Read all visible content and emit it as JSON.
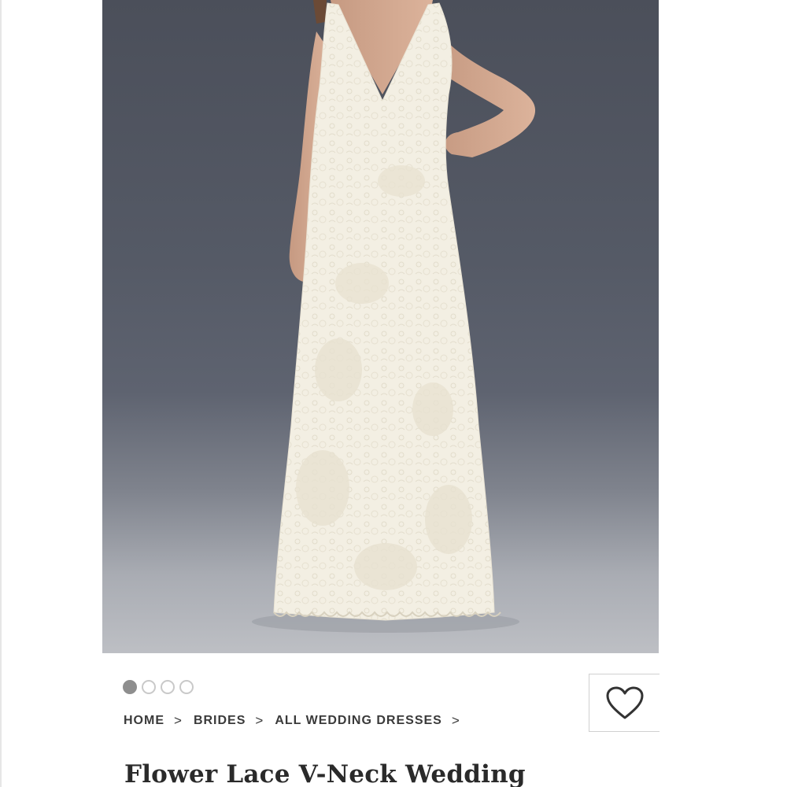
{
  "product": {
    "image_alt": "Model wearing ivory flower lace V-neck sheath wedding dress",
    "title": "Flower Lace V-Neck Wedding"
  },
  "carousel": {
    "dots": [
      {
        "active": true
      },
      {
        "active": false
      },
      {
        "active": false
      },
      {
        "active": false
      }
    ]
  },
  "breadcrumb": {
    "items": [
      {
        "label": "HOME"
      },
      {
        "label": "BRIDES"
      },
      {
        "label": "ALL WEDDING DRESSES"
      }
    ],
    "separator": ">"
  },
  "wishlist": {
    "icon": "heart-icon"
  },
  "colors": {
    "backdrop": "#555a66",
    "dress": "#f4f0e6",
    "text": "#3a3a3a",
    "dot_active": "#8e8e8e"
  }
}
